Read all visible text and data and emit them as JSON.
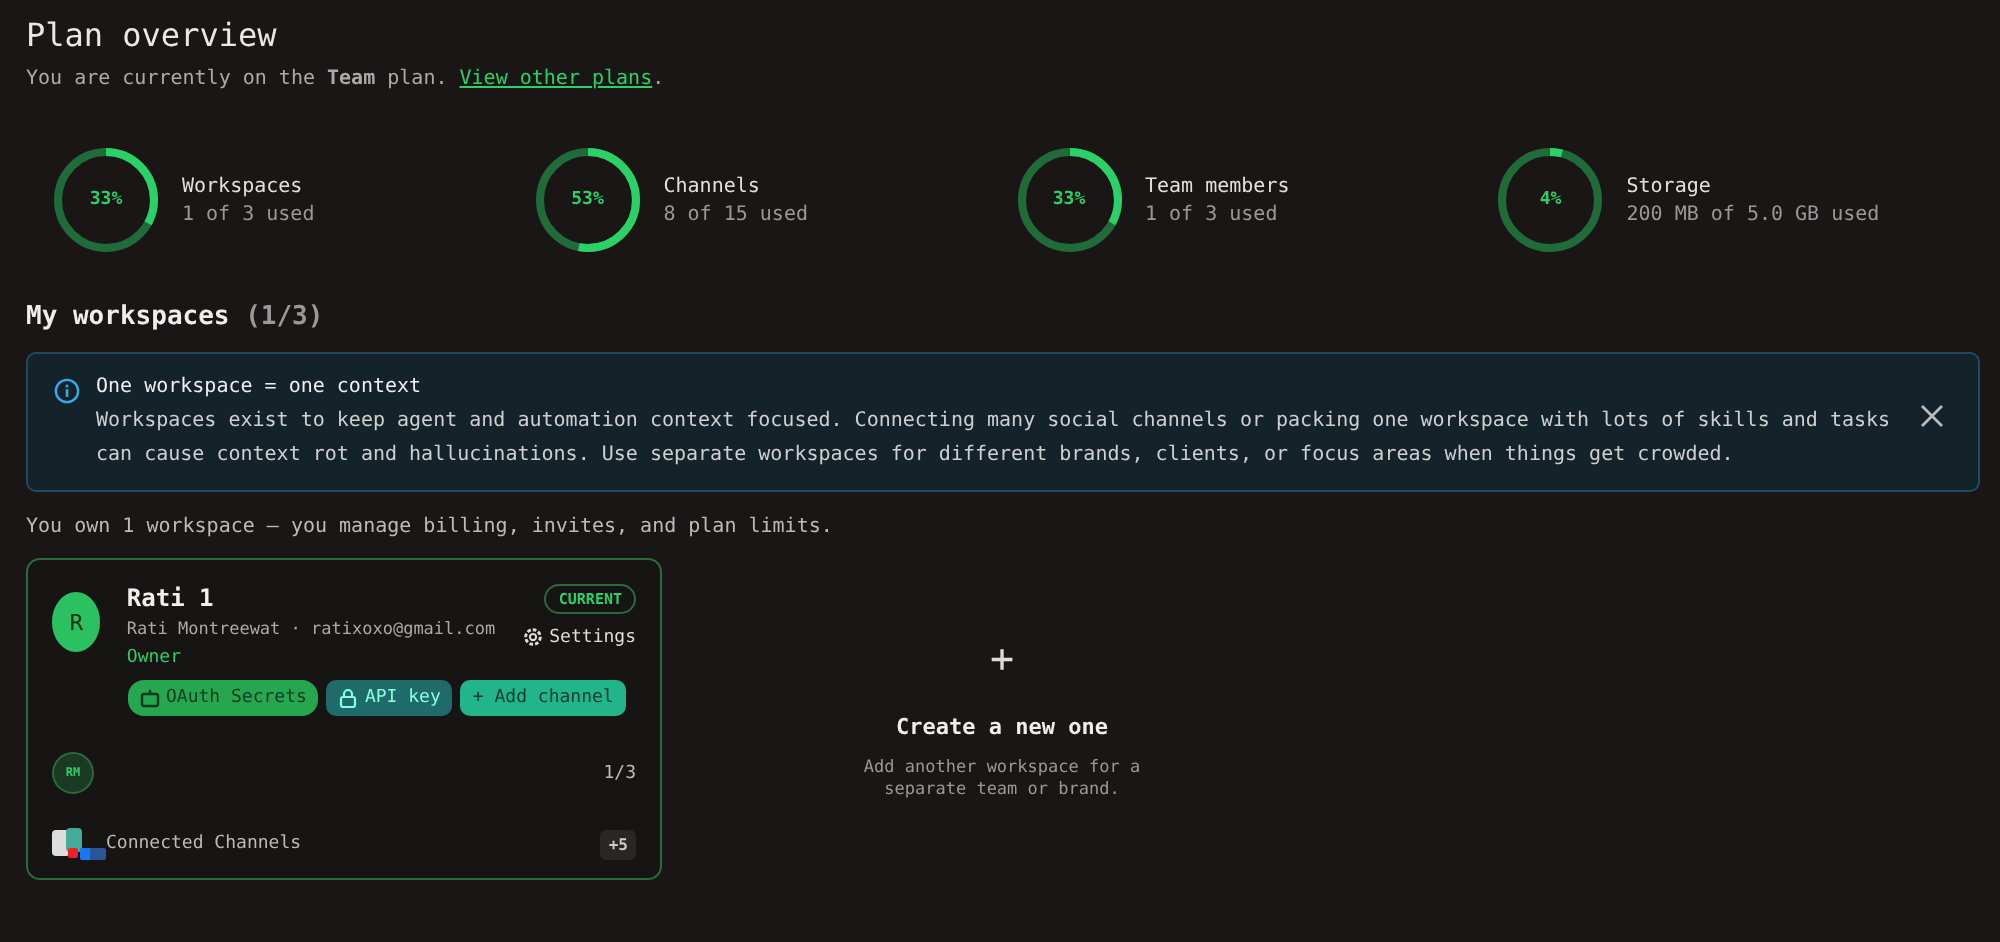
{
  "header": {
    "title": "Plan overview",
    "subtitle": "You are currently on the **Team** plan.",
    "link": "View other plans",
    "after_link": "."
  },
  "stats": [
    {
      "percent": "33%",
      "label": "Workspaces",
      "usage": "1 of 3 used"
    },
    {
      "percent": "53%",
      "label": "Channels",
      "usage": "8 of 15 used"
    },
    {
      "percent": "33%",
      "label": "Team members",
      "usage": "1 of 3 used"
    },
    {
      "percent": "4%",
      "label": "Storage",
      "usage": "200 MB of 5.0 GB used"
    }
  ],
  "section": {
    "title": "My workspaces",
    "count": "(1/3)"
  },
  "notice": {
    "title": "One workspace = one context",
    "body": "Workspaces exist to keep agent and automation context focused. Connecting many social channels or packing one workspace with lots of skills and tasks can cause context rot and hallucinations. Use separate workspaces for different brands, clients, or focus areas when things get crowded."
  },
  "ownership": "You own 1 workspace — you manage billing, invites, and plan limits.",
  "workspace": {
    "initial": "R",
    "name": "Rati 1",
    "owner_line": "Rati Montreewat · ratixoxo@gmail.com",
    "role": "Owner",
    "badge": "CURRENT",
    "settings": "Settings",
    "actions": [
      {
        "kind": "oauth",
        "label": "OAuth Secrets"
      },
      {
        "kind": "apikey",
        "label": "API key"
      },
      {
        "kind": "add",
        "label": "+ Add channel"
      }
    ],
    "member_initials": "RM",
    "member_count": "1/3",
    "channels_label": "Connected Channels",
    "more_channels": "+5"
  },
  "create": {
    "icon": "+",
    "title": "Create a new one",
    "body": "Add another workspace for a separate team or brand."
  }
}
